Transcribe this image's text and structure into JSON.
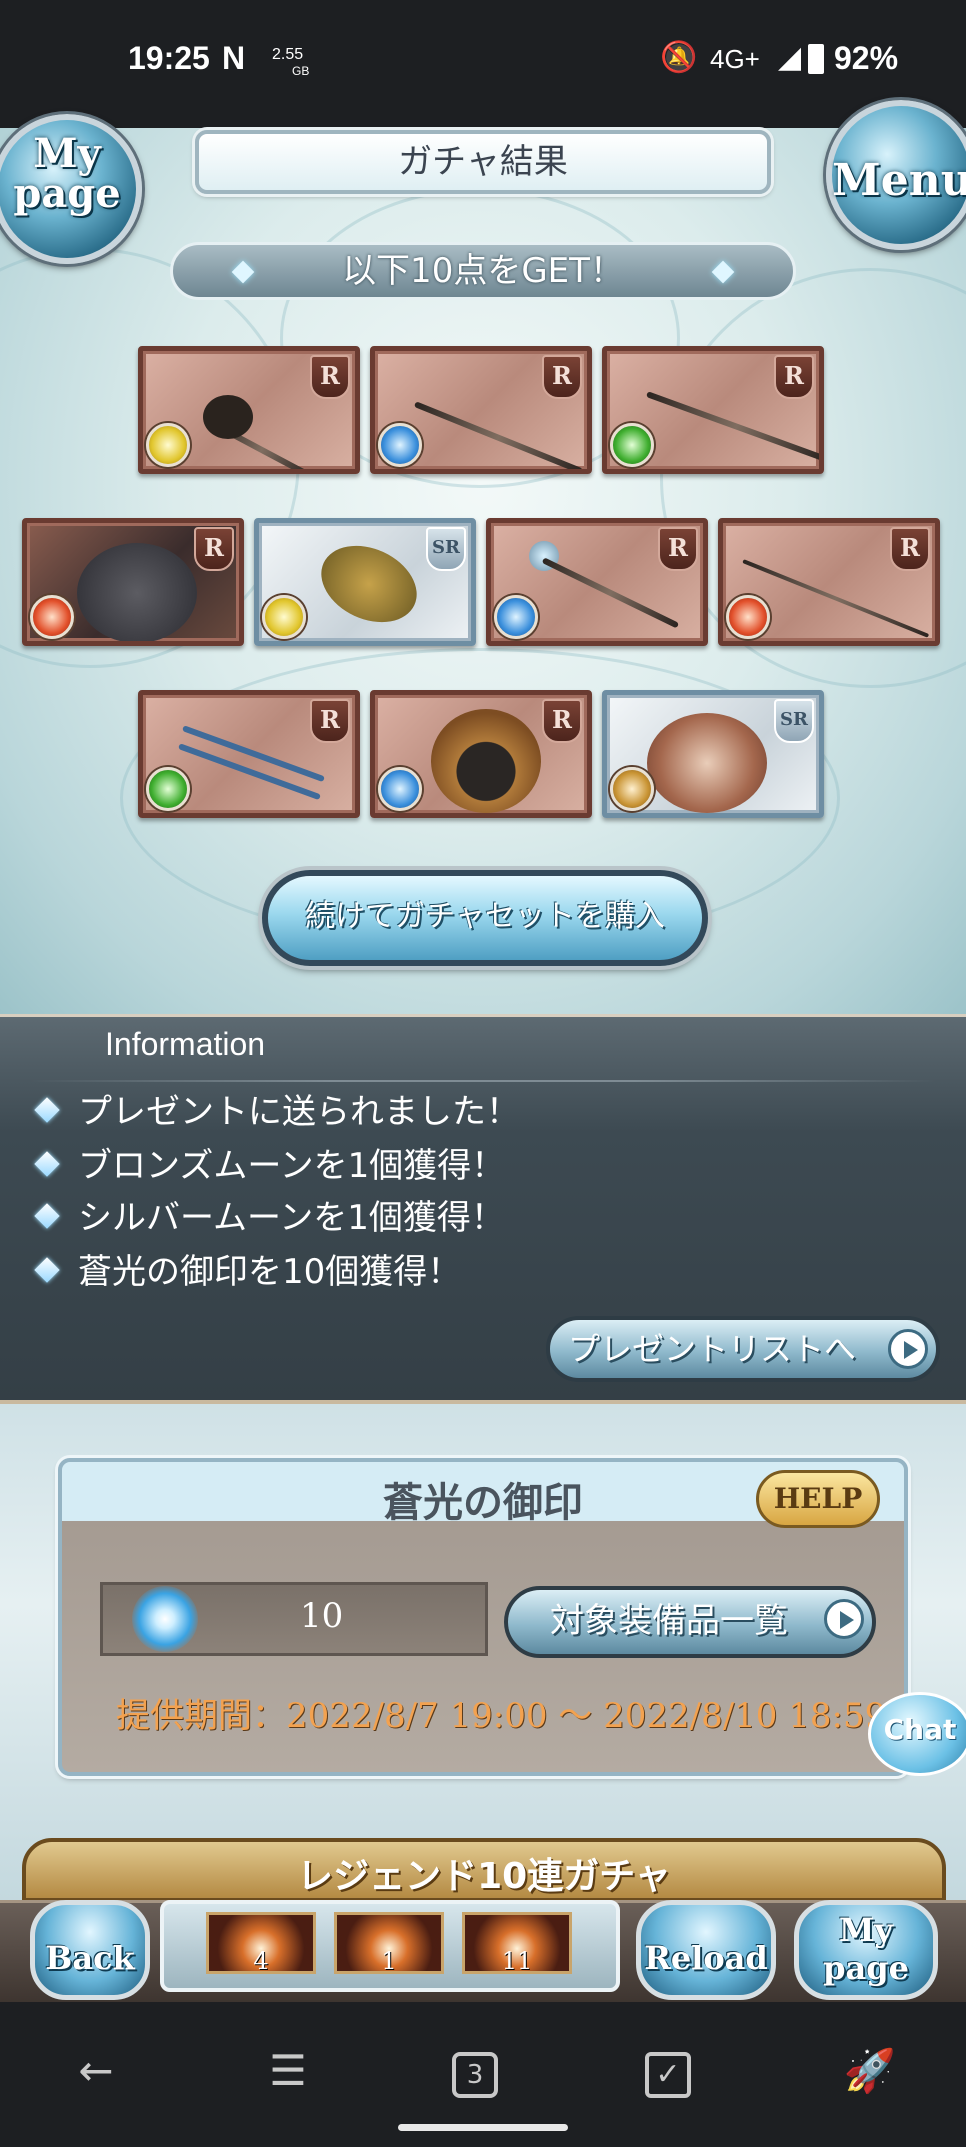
{
  "status_bar": {
    "time": "19:25",
    "data_speed": "2.55",
    "data_unit": "GB",
    "network": "4G+",
    "battery": "92%"
  },
  "header": {
    "mypage_label": "My page",
    "mypage_line1": "My",
    "mypage_line2": "page",
    "menu_label": "Menu",
    "title": "ガチャ結果"
  },
  "result": {
    "get_label": "以下10点をGET！",
    "items": [
      {
        "rarity": "R",
        "element": "light",
        "kind": "axe"
      },
      {
        "rarity": "R",
        "element": "water",
        "kind": "sword"
      },
      {
        "rarity": "R",
        "element": "wind",
        "kind": "spear"
      },
      {
        "rarity": "R",
        "element": "fire",
        "kind": "summon"
      },
      {
        "rarity": "SR",
        "element": "light",
        "kind": "summon"
      },
      {
        "rarity": "R",
        "element": "water",
        "kind": "staff"
      },
      {
        "rarity": "R",
        "element": "fire",
        "kind": "katana"
      },
      {
        "rarity": "R",
        "element": "wind",
        "kind": "claw"
      },
      {
        "rarity": "R",
        "element": "water",
        "kind": "summon"
      },
      {
        "rarity": "SR",
        "element": "earth",
        "kind": "summon"
      }
    ],
    "buy_again_label": "続けてガチャセットを購入"
  },
  "information": {
    "title": "Information",
    "lines": [
      "プレゼントに送られました！",
      "ブロンズムーンを1個獲得！",
      "シルバームーンを1個獲得！",
      "蒼光の御印を10個獲得！"
    ],
    "present_list_label": "プレゼントリストへ"
  },
  "seal": {
    "title": "蒼光の御印",
    "help_label": "HELP",
    "count": "10",
    "equip_list_label": "対象装備品一覧",
    "period": "提供期間：2022/8/7 19:00 〜 2022/8/10 18:59"
  },
  "chat_label": "Chat",
  "next_banner": "レジェンド10連ガチャ",
  "bottom_bar": {
    "back_label": "Back",
    "items": [
      {
        "count": "4"
      },
      {
        "count": "1"
      },
      {
        "count": "11"
      }
    ],
    "reload_label": "Reload",
    "mypage_label": "My page",
    "mypage_line1": "My",
    "mypage_line2": "page"
  },
  "nav": {
    "tab_count": "3"
  },
  "colors": {
    "accent_blue": "#6bb3cf",
    "info_bg": "#3d4a52",
    "period_orange": "#f3a250",
    "card_bronze": "#b98a7c"
  }
}
